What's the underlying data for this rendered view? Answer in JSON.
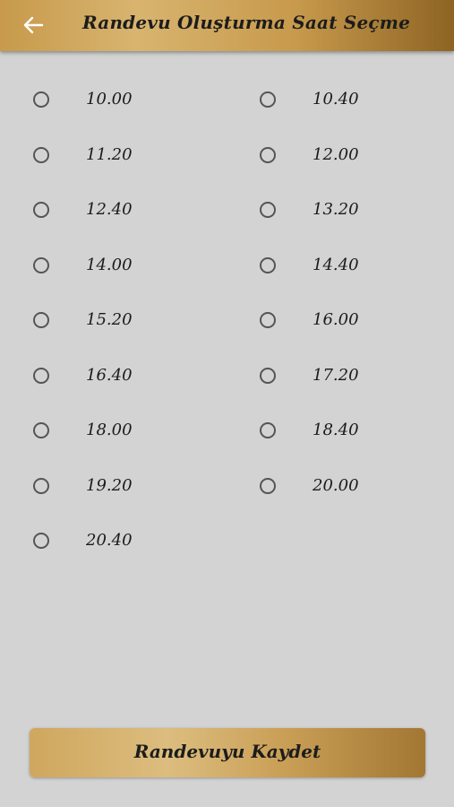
{
  "header": {
    "title": "Randevu Oluşturma Saat Seçme",
    "back_icon": "arrow-left-icon"
  },
  "slots": [
    {
      "label": "10.00",
      "selected": false
    },
    {
      "label": "10.40",
      "selected": false
    },
    {
      "label": "11.20",
      "selected": false
    },
    {
      "label": "12.00",
      "selected": false
    },
    {
      "label": "12.40",
      "selected": false
    },
    {
      "label": "13.20",
      "selected": false
    },
    {
      "label": "14.00",
      "selected": false
    },
    {
      "label": "14.40",
      "selected": false
    },
    {
      "label": "15.20",
      "selected": false
    },
    {
      "label": "16.00",
      "selected": false
    },
    {
      "label": "16.40",
      "selected": false
    },
    {
      "label": "17.20",
      "selected": false
    },
    {
      "label": "18.00",
      "selected": false
    },
    {
      "label": "18.40",
      "selected": false
    },
    {
      "label": "19.20",
      "selected": false
    },
    {
      "label": "20.00",
      "selected": false
    },
    {
      "label": "20.40",
      "selected": false
    }
  ],
  "actions": {
    "save_label": "Randevuyu Kaydet"
  },
  "colors": {
    "accent_gold": "#c79a4c",
    "background": "#d3d3d3"
  }
}
